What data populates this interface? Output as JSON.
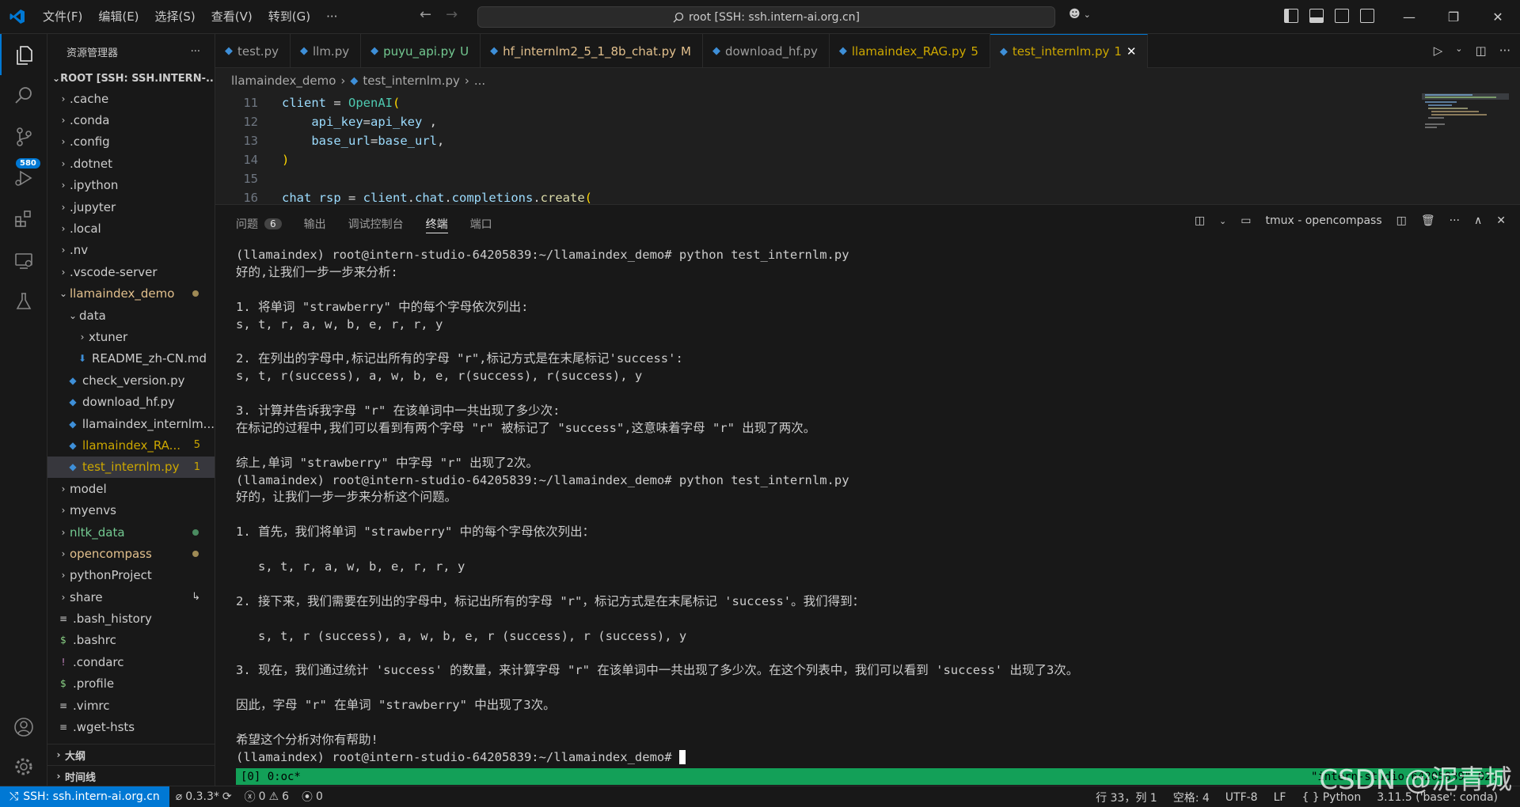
{
  "titlebar": {
    "menu": [
      "文件(F)",
      "编辑(E)",
      "选择(S)",
      "查看(V)",
      "转到(G)",
      "···"
    ],
    "command_center": "root [SSH: ssh.intern-ai.org.cn]"
  },
  "activity": {
    "scm_badge": "580"
  },
  "sidebar": {
    "title": "资源管理器",
    "root": "ROOT [SSH: SSH.INTERN-...",
    "items": [
      {
        "label": ".cache",
        "indent": 0,
        "chev": "›",
        "color": "#cccccc"
      },
      {
        "label": ".conda",
        "indent": 0,
        "chev": "›",
        "color": "#cccccc"
      },
      {
        "label": ".config",
        "indent": 0,
        "chev": "›",
        "color": "#cccccc"
      },
      {
        "label": ".dotnet",
        "indent": 0,
        "chev": "›",
        "color": "#cccccc"
      },
      {
        "label": ".ipython",
        "indent": 0,
        "chev": "›",
        "color": "#cccccc"
      },
      {
        "label": ".jupyter",
        "indent": 0,
        "chev": "›",
        "color": "#cccccc"
      },
      {
        "label": ".local",
        "indent": 0,
        "chev": "›",
        "color": "#cccccc"
      },
      {
        "label": ".nv",
        "indent": 0,
        "chev": "›",
        "color": "#cccccc"
      },
      {
        "label": ".vscode-server",
        "indent": 0,
        "chev": "›",
        "color": "#cccccc"
      },
      {
        "label": "llamaindex_demo",
        "indent": 0,
        "chev": "⌄",
        "color": "#e2c08d",
        "dot": "#9e8a55"
      },
      {
        "label": "data",
        "indent": 1,
        "chev": "⌄",
        "color": "#cccccc"
      },
      {
        "label": "xtuner",
        "indent": 2,
        "chev": "›",
        "color": "#cccccc"
      },
      {
        "label": "README_zh-CN.md",
        "indent": 2,
        "icon": "md",
        "color": "#cccccc"
      },
      {
        "label": "check_version.py",
        "indent": 1,
        "icon": "py",
        "color": "#cccccc"
      },
      {
        "label": "download_hf.py",
        "indent": 1,
        "icon": "py",
        "color": "#cccccc"
      },
      {
        "label": "llamaindex_internlm...",
        "indent": 1,
        "icon": "py",
        "color": "#cccccc"
      },
      {
        "label": "llamaindex_RA...",
        "indent": 1,
        "icon": "py",
        "color": "#cca700",
        "badge": "5"
      },
      {
        "label": "test_internlm.py",
        "indent": 1,
        "icon": "py",
        "color": "#cca700",
        "badge": "1",
        "selected": true
      },
      {
        "label": "model",
        "indent": 0,
        "chev": "›",
        "color": "#cccccc"
      },
      {
        "label": "myenvs",
        "indent": 0,
        "chev": "›",
        "color": "#cccccc"
      },
      {
        "label": "nltk_data",
        "indent": 0,
        "chev": "›",
        "color": "#73c991",
        "dot": "#4a8b60"
      },
      {
        "label": "opencompass",
        "indent": 0,
        "chev": "›",
        "color": "#e2c08d",
        "dot": "#9e8a55"
      },
      {
        "label": "pythonProject",
        "indent": 0,
        "chev": "›",
        "color": "#cccccc"
      },
      {
        "label": "share",
        "indent": 0,
        "chev": "›",
        "color": "#cccccc",
        "badge": "↳"
      },
      {
        "label": ".bash_history",
        "indent": 0,
        "icon": "≡",
        "color": "#cccccc"
      },
      {
        "label": ".bashrc",
        "indent": 0,
        "icon": "$",
        "color": "#cccccc"
      },
      {
        "label": ".condarc",
        "indent": 0,
        "icon": "!",
        "color": "#cccccc"
      },
      {
        "label": ".profile",
        "indent": 0,
        "icon": "$",
        "color": "#cccccc"
      },
      {
        "label": ".vimrc",
        "indent": 0,
        "icon": "≡",
        "color": "#cccccc"
      },
      {
        "label": ".wget-hsts",
        "indent": 0,
        "icon": "≡",
        "color": "#cccccc"
      }
    ],
    "outline": "大纲",
    "timeline": "时间线"
  },
  "tabs": [
    {
      "label": "test.py",
      "suffix": "",
      "color": "#9d9d9d"
    },
    {
      "label": "llm.py",
      "suffix": "",
      "color": "#9d9d9d"
    },
    {
      "label": "puyu_api.py",
      "suffix": "U",
      "color": "#73c991"
    },
    {
      "label": "hf_internlm2_5_1_8b_chat.py",
      "suffix": "M",
      "color": "#e2c08d"
    },
    {
      "label": "download_hf.py",
      "suffix": "",
      "color": "#9d9d9d"
    },
    {
      "label": "llamaindex_RAG.py",
      "suffix": "5",
      "color": "#cca700"
    },
    {
      "label": "test_internlm.py",
      "suffix": "1",
      "color": "#cca700",
      "active": true
    }
  ],
  "breadcrumb": [
    "llamaindex_demo",
    "test_internlm.py",
    "..."
  ],
  "code": [
    {
      "ln": "11",
      "parts": [
        [
          "client",
          "#9cdcfe"
        ],
        [
          " = ",
          "#d4d4d4"
        ],
        [
          "OpenAI",
          "#4ec9b0"
        ],
        [
          "(",
          "#ffd700"
        ]
      ]
    },
    {
      "ln": "12",
      "parts": [
        [
          "    api_key",
          "#9cdcfe"
        ],
        [
          "=",
          "#d4d4d4"
        ],
        [
          "api_key",
          "#9cdcfe"
        ],
        [
          " ,",
          "#d4d4d4"
        ]
      ]
    },
    {
      "ln": "13",
      "parts": [
        [
          "    base_url",
          "#9cdcfe"
        ],
        [
          "=",
          "#d4d4d4"
        ],
        [
          "base_url",
          "#9cdcfe"
        ],
        [
          ",",
          "#d4d4d4"
        ]
      ]
    },
    {
      "ln": "14",
      "parts": [
        [
          ")",
          "#ffd700"
        ]
      ]
    },
    {
      "ln": "15",
      "parts": []
    },
    {
      "ln": "16",
      "parts": [
        [
          "chat_rsp",
          "#9cdcfe"
        ],
        [
          " = ",
          "#d4d4d4"
        ],
        [
          "client",
          "#9cdcfe"
        ],
        [
          ".",
          "#d4d4d4"
        ],
        [
          "chat",
          "#9cdcfe"
        ],
        [
          ".",
          "#d4d4d4"
        ],
        [
          "completions",
          "#9cdcfe"
        ],
        [
          ".",
          "#d4d4d4"
        ],
        [
          "create",
          "#dcdcaa"
        ],
        [
          "(",
          "#ffd700"
        ]
      ]
    }
  ],
  "panel": {
    "tabs": [
      {
        "label": "问题",
        "badge": "6"
      },
      {
        "label": "输出"
      },
      {
        "label": "调试控制台"
      },
      {
        "label": "终端",
        "active": true
      },
      {
        "label": "端口"
      }
    ],
    "terminal_name": "tmux - opencompass"
  },
  "terminal": [
    "(llamaindex) root@intern-studio-64205839:~/llamaindex_demo# python test_internlm.py",
    "好的,让我们一步一步来分析:",
    "",
    "1. 将单词 \"strawberry\" 中的每个字母依次列出:",
    "s, t, r, a, w, b, e, r, r, y",
    "",
    "2. 在列出的字母中,标记出所有的字母 \"r\",标记方式是在末尾标记'success':",
    "s, t, r(success), a, w, b, e, r(success), r(success), y",
    "",
    "3. 计算并告诉我字母 \"r\" 在该单词中一共出现了多少次:",
    "在标记的过程中,我们可以看到有两个字母 \"r\" 被标记了 \"success\",这意味着字母 \"r\" 出现了两次。",
    "",
    "综上,单词 \"strawberry\" 中字母 \"r\" 出现了2次。",
    "(llamaindex) root@intern-studio-64205839:~/llamaindex_demo# python test_internlm.py",
    "好的，让我们一步一步来分析这个问题。",
    "",
    "1. 首先，我们将单词 \"strawberry\" 中的每个字母依次列出：",
    "",
    "   s, t, r, a, w, b, e, r, r, y",
    "",
    "2. 接下来，我们需要在列出的字母中，标记出所有的字母 \"r\"，标记方式是在末尾标记 'success'。我们得到：",
    "",
    "   s, t, r (success), a, w, b, e, r (success), r (success), y",
    "",
    "3. 现在，我们通过统计 'success' 的数量，来计算字母 \"r\" 在该单词中一共出现了多少次。在这个列表中，我们可以看到 'success' 出现了3次。",
    "",
    "因此，字母 \"r\" 在单词 \"strawberry\" 中出现了3次。",
    "",
    "希望这个分析对你有帮助!"
  ],
  "prompt": "(llamaindex) root@intern-studio-64205839:~/llamaindex_demo# ",
  "tmux": {
    "left": "[0] 0:oc*",
    "right": "\"intern-studio-64205839\" 02:"
  },
  "status": {
    "remote": "SSH: ssh.intern-ai.org.cn",
    "version": "0.3.3*",
    "errors": "0",
    "warnings": "6",
    "ports": "0",
    "position": "行 33，列 1",
    "spaces": "空格: 4",
    "encoding": "UTF-8",
    "eol": "LF",
    "language": "Python",
    "interpreter": "3.11.5 ('base': conda)"
  },
  "watermark": "CSDN @泥青城"
}
